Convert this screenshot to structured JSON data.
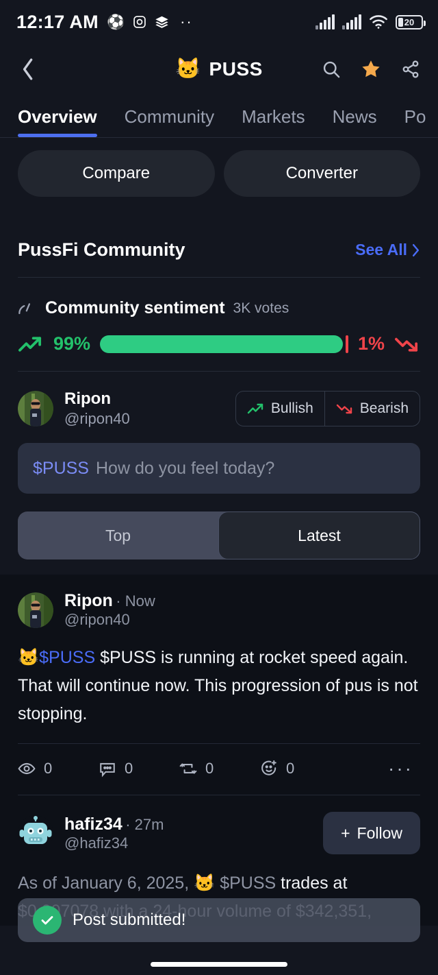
{
  "status_bar": {
    "time": "12:17 AM",
    "icons": [
      "soccer-ball-icon",
      "instagram-icon",
      "layers-icon",
      "more-dots-icon"
    ],
    "battery_level": "20"
  },
  "header": {
    "back_label": "chevron-left-icon",
    "coin_emoji": "🐱",
    "title": "PUSS",
    "actions": [
      "search-icon",
      "favorite-star-icon",
      "share-icon"
    ]
  },
  "tabs": [
    {
      "label": "Overview",
      "active": true
    },
    {
      "label": "Community",
      "active": false
    },
    {
      "label": "Markets",
      "active": false
    },
    {
      "label": "News",
      "active": false
    },
    {
      "label": "Po",
      "active": false
    }
  ],
  "quick_actions": [
    {
      "label": "Compare"
    },
    {
      "label": "Converter"
    }
  ],
  "community": {
    "section_title": "PussFi Community",
    "see_all": "See All",
    "sentiment": {
      "label": "Community sentiment",
      "votes": "3K votes",
      "bullish_pct": "99%",
      "bearish_pct": "1%",
      "bullish_value": 99,
      "bearish_value": 1,
      "bullish_color": "#2ecc83",
      "bearish_color": "#f0444a"
    },
    "compose": {
      "user_name": "Ripon",
      "user_handle": "@ripon40",
      "bullish_label": "Bullish",
      "bearish_label": "Bearish",
      "ticker": "$PUSS",
      "placeholder": "How do you feel today?"
    },
    "sort_tabs": [
      {
        "label": "Top",
        "active": false
      },
      {
        "label": "Latest",
        "active": true
      }
    ],
    "posts": [
      {
        "author": "Ripon",
        "time": "Now",
        "handle": "@ripon40",
        "avatar": "photo-avatar",
        "body_emoji": "🐱",
        "body_ticker": "$PUSS",
        "body_text": "$PUSS is running at rocket speed again.  That will continue now.  This progression of pus is not stopping.",
        "stats": {
          "views": "0",
          "comments": "0",
          "reposts": "0",
          "reactions": "0"
        }
      },
      {
        "author": "hafiz34",
        "time": "27m",
        "handle": "@hafiz34",
        "avatar": "robot-avatar",
        "follow_label": "Follow",
        "body_prefix": "As of January 6, 2025, ",
        "body_emoji": "🐱",
        "body_ticker": "$PUSS",
        "body_text": " trades at $0.007078 with a 24-hour volume of $342,351,"
      }
    ]
  },
  "toast": {
    "message": "Post submitted!",
    "icon": "check-circle-icon",
    "color": "#2bb673"
  }
}
